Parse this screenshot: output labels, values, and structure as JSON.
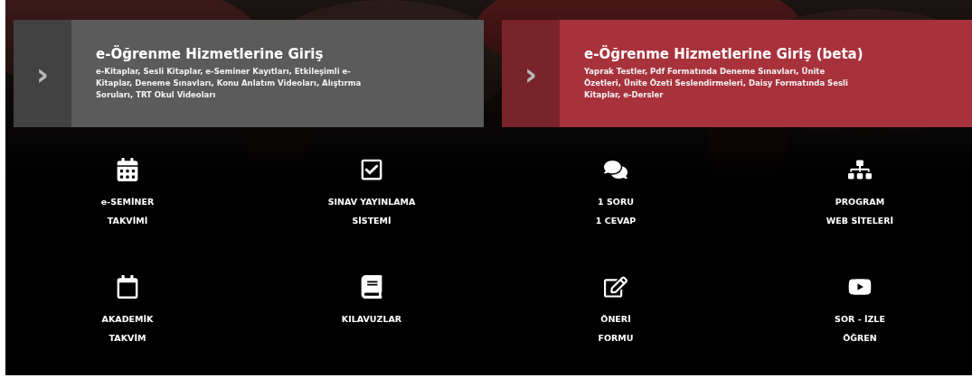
{
  "cards": [
    {
      "title": "e-Öğrenme Hizmetlerine Giriş",
      "description": "e-Kitaplar, Sesli Kitaplar, e-Seminer Kayıtları, Etkileşimli e-Kitaplar, Deneme Sınavları, Konu Anlatım Videoları, Alıştırma Soruları, TRT Okul Videoları",
      "color": "#5b5b5b",
      "arrow": "›"
    },
    {
      "title": "e-Öğrenme Hizmetlerine Giriş (beta)",
      "description": "Yaprak Testler, Pdf Formatında Deneme Sınavları, Ünite Özetleri, Ünite Özeti Seslendirmeleri, Daisy Formatında Sesli Kitaplar, e-Dersler",
      "color": "#a8323b",
      "arrow": "›"
    }
  ],
  "links": [
    {
      "lines": [
        "e-SEMİNER",
        "TAKVİMİ"
      ]
    },
    {
      "lines": [
        "SINAV YAYINLAMA",
        "SİSTEMİ"
      ]
    },
    {
      "lines": [
        "1 SORU",
        "1 CEVAP"
      ]
    },
    {
      "lines": [
        "PROGRAM",
        "WEB SİTELERİ"
      ]
    },
    {
      "lines": [
        "AKADEMİK",
        "TAKVİM"
      ]
    },
    {
      "lines": [
        "KILAVUZLAR"
      ]
    },
    {
      "lines": [
        "ÖNERİ",
        "FORMU"
      ]
    },
    {
      "lines": [
        "SOR - İZLE",
        "ÖĞREN"
      ]
    }
  ]
}
